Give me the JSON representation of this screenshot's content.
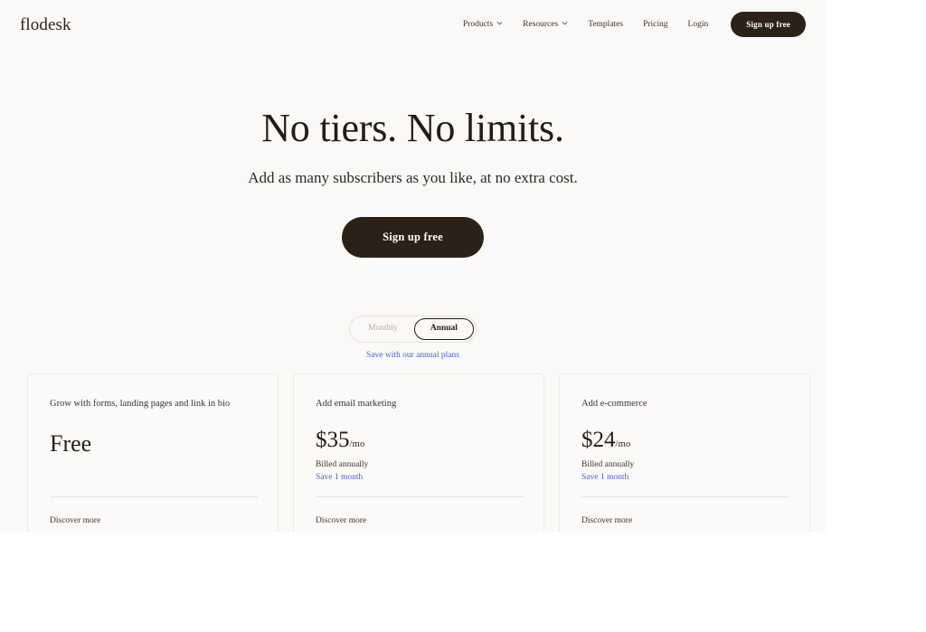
{
  "header": {
    "logo": "flodesk",
    "nav": [
      {
        "label": "Products",
        "icon": "chevron-down-icon",
        "has_chevron": true
      },
      {
        "label": "Resources",
        "icon": "chevron-down-icon",
        "has_chevron": true
      },
      {
        "label": "Templates",
        "has_chevron": false
      },
      {
        "label": "Pricing",
        "has_chevron": false
      },
      {
        "label": "Login",
        "has_chevron": false
      }
    ],
    "cta_label": "Sign up free"
  },
  "hero": {
    "title": "No tiers. No limits.",
    "subtitle": "Add as many subscribers as you like, at no extra cost.",
    "cta_label": "Sign up free"
  },
  "billing_toggle": {
    "options": [
      {
        "label": "Monthly",
        "active": false
      },
      {
        "label": "Annual",
        "active": true
      }
    ],
    "selected": "Annual",
    "note": "Save with our annual plans"
  },
  "plans": [
    {
      "tagline": "Grow with forms, landing pages and link in bio",
      "price": "Free",
      "unit": "",
      "billed": "",
      "save": "",
      "more_label": "Discover more"
    },
    {
      "tagline": "Add email marketing",
      "price": "$35",
      "unit": "/mo",
      "billed": "Billed annually",
      "save": "Save 1 month",
      "more_label": "Discover more"
    },
    {
      "tagline": "Add e-commerce",
      "price": "$24",
      "unit": "/mo",
      "billed": "Billed annually",
      "save": "Save 1 month",
      "more_label": "Discover more"
    }
  ],
  "colors": {
    "page_background": "#faf9f7",
    "viewport_background": "#ffffff",
    "ink": "#241c18",
    "dark_button": "#2b2119",
    "link_blue": "#4a5fd0",
    "card_border": "#eceae6",
    "muted_text": "#b2aca6"
  }
}
